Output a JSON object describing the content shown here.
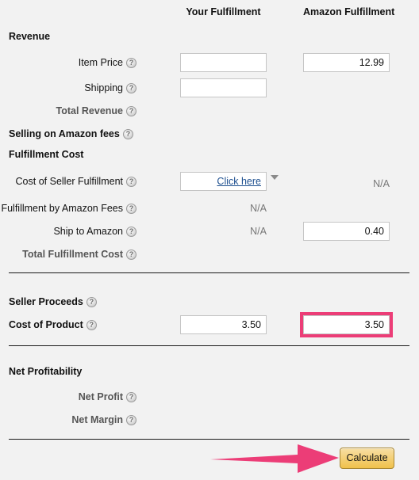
{
  "columns": {
    "your_fulfillment": "Your Fulfillment",
    "amazon_fulfillment": "Amazon Fulfillment"
  },
  "sections": {
    "revenue": {
      "title": "Revenue",
      "item_price": {
        "label": "Item Price",
        "your_value": "",
        "amazon_value": "12.99"
      },
      "shipping": {
        "label": "Shipping",
        "your_value": "",
        "amazon_value": ""
      },
      "total_revenue": {
        "label": "Total Revenue",
        "your_value": "",
        "amazon_value": ""
      }
    },
    "selling_fees": {
      "title": "Selling on Amazon fees"
    },
    "fulfillment_cost": {
      "title": "Fulfillment Cost",
      "cost_of_seller_fulfillment": {
        "label": "Cost of Seller Fulfillment",
        "your_value": "Click here",
        "amazon_value": "N/A"
      },
      "fulfillment_by_amazon_fees": {
        "label": "Fulfillment by Amazon Fees",
        "your_value": "N/A",
        "amazon_value": ""
      },
      "ship_to_amazon": {
        "label": "Ship to Amazon",
        "your_value": "N/A",
        "amazon_value": "0.40"
      },
      "total_fulfillment_cost": {
        "label": "Total Fulfillment Cost",
        "your_value": "",
        "amazon_value": ""
      }
    },
    "seller_proceeds": {
      "title": "Seller Proceeds",
      "cost_of_product": {
        "label": "Cost of Product",
        "your_value": "3.50",
        "amazon_value": "3.50"
      }
    },
    "net_profitability": {
      "title": "Net Profitability",
      "net_profit": {
        "label": "Net Profit",
        "your_value": "",
        "amazon_value": ""
      },
      "net_margin": {
        "label": "Net Margin",
        "your_value": "",
        "amazon_value": ""
      }
    }
  },
  "actions": {
    "calculate_label": "Calculate"
  },
  "colors": {
    "background": "#f2f2f2",
    "annotation_pink": "#ec3d77",
    "button_gold_top": "#f7dfa5",
    "button_gold_bottom": "#f0c14b",
    "button_border": "#a88734",
    "link_blue": "#1d4f8f",
    "muted_text": "#777777"
  },
  "icons": {
    "help": "help-icon",
    "dropdown_caret": "chevron-down-icon",
    "annotation_arrow": "arrow-right-annotation"
  }
}
